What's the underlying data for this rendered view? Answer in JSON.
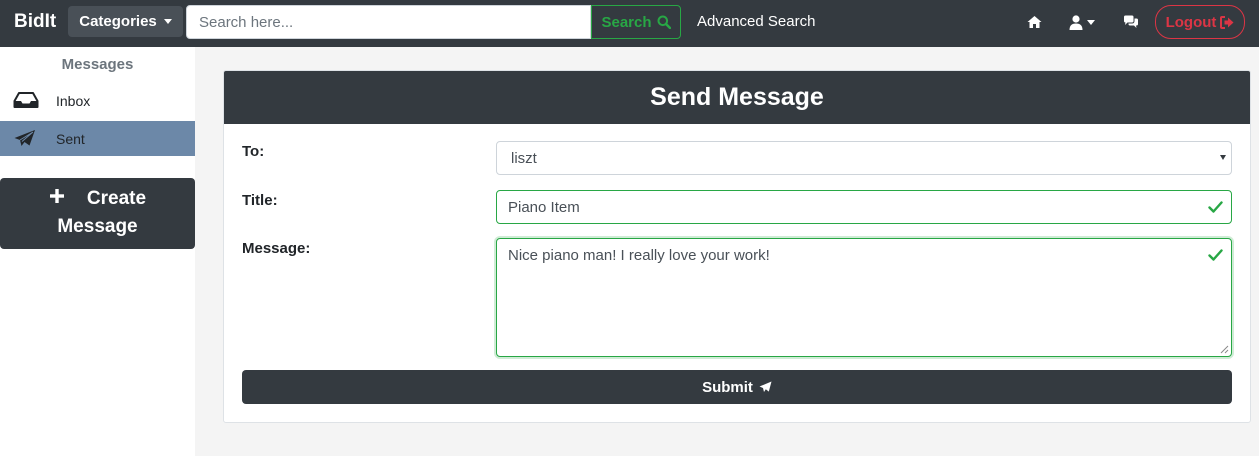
{
  "navbar": {
    "brand": "BidIt",
    "categories_label": "Categories",
    "search_placeholder": "Search here...",
    "search_label": "Search",
    "advanced_search": "Advanced Search",
    "logout_label": "Logout"
  },
  "sidebar": {
    "heading": "Messages",
    "items": [
      {
        "label": "Inbox",
        "icon": "inbox-icon",
        "active": false
      },
      {
        "label": "Sent",
        "icon": "paper-plane-icon",
        "active": true
      }
    ],
    "create_line1": "Create",
    "create_line2": "Message"
  },
  "form": {
    "title": "Send Message",
    "to_label": "To:",
    "to_value": "liszt",
    "title_label": "Title:",
    "title_value": "Piano Item",
    "message_label": "Message:",
    "message_value": "Nice piano man! I really love your work!",
    "submit_label": "Submit"
  },
  "colors": {
    "navbar": "#343a40",
    "success": "#28a745",
    "danger": "#dc3545",
    "active_item": "#6c88a8",
    "main_bg": "#f4f4f4"
  }
}
